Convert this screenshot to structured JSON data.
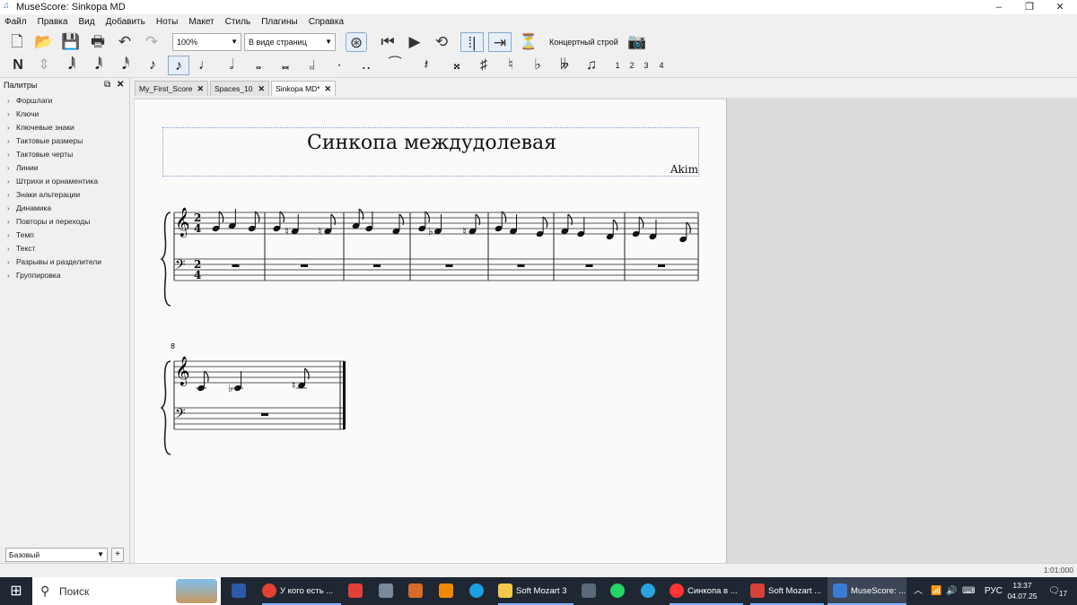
{
  "window": {
    "title": "MuseScore: Sinkopa MD",
    "minimize": "‒",
    "maximize": "❐",
    "close": "✕"
  },
  "menu": [
    "Файл",
    "Правка",
    "Вид",
    "Добавить",
    "Ноты",
    "Макет",
    "Стиль",
    "Плагины",
    "Справка"
  ],
  "toolbar": {
    "zoom": "100%",
    "view_mode": "В виде страниц",
    "concert_pitch": "Концертный строй"
  },
  "note_input": {
    "voices": [
      "1",
      "2",
      "3",
      "4"
    ]
  },
  "palette": {
    "header": "Палитры",
    "items": [
      "Форшлаги",
      "Ключи",
      "Ключевые знаки",
      "Тактовые размеры",
      "Тактовые черты",
      "Линии",
      "Штрихи и орнаментика",
      "Знаки альтерации",
      "Динамика",
      "Повторы и переходы",
      "Темп",
      "Текст",
      "Разрывы и разделители",
      "Группировка"
    ],
    "workspace": "Базовый",
    "add": "+"
  },
  "tabs": [
    {
      "label": "My_First_Score"
    },
    {
      "label": "Spaces_10"
    },
    {
      "label": "Sinkopa MD*"
    }
  ],
  "score": {
    "title": "Синкопа междудолевая",
    "composer": "Akim",
    "time_signature": "2/4",
    "measure_number_system2": "8"
  },
  "status": {
    "time": "1:01:000"
  },
  "taskbar": {
    "search_placeholder": "Поиск",
    "apps": [
      {
        "label": "У кого есть ...",
        "icon": "chrome-icon",
        "color": "#e34133"
      },
      {
        "label": "Soft Mozart 3",
        "icon": "folder-icon",
        "color": "#f2c94c"
      },
      {
        "label": "Синкопа в ...",
        "icon": "yandex-icon",
        "color": "#ff3333"
      },
      {
        "label": "Soft Mozart ...",
        "icon": "softmozart-icon",
        "color": "#d8403a"
      },
      {
        "label": "MuseScore: ...",
        "icon": "musescore-icon",
        "color": "#3a7bd5"
      }
    ],
    "lang": "РУС",
    "clock_time": "13:37",
    "clock_date": "04.07.25",
    "notifications": "17"
  }
}
